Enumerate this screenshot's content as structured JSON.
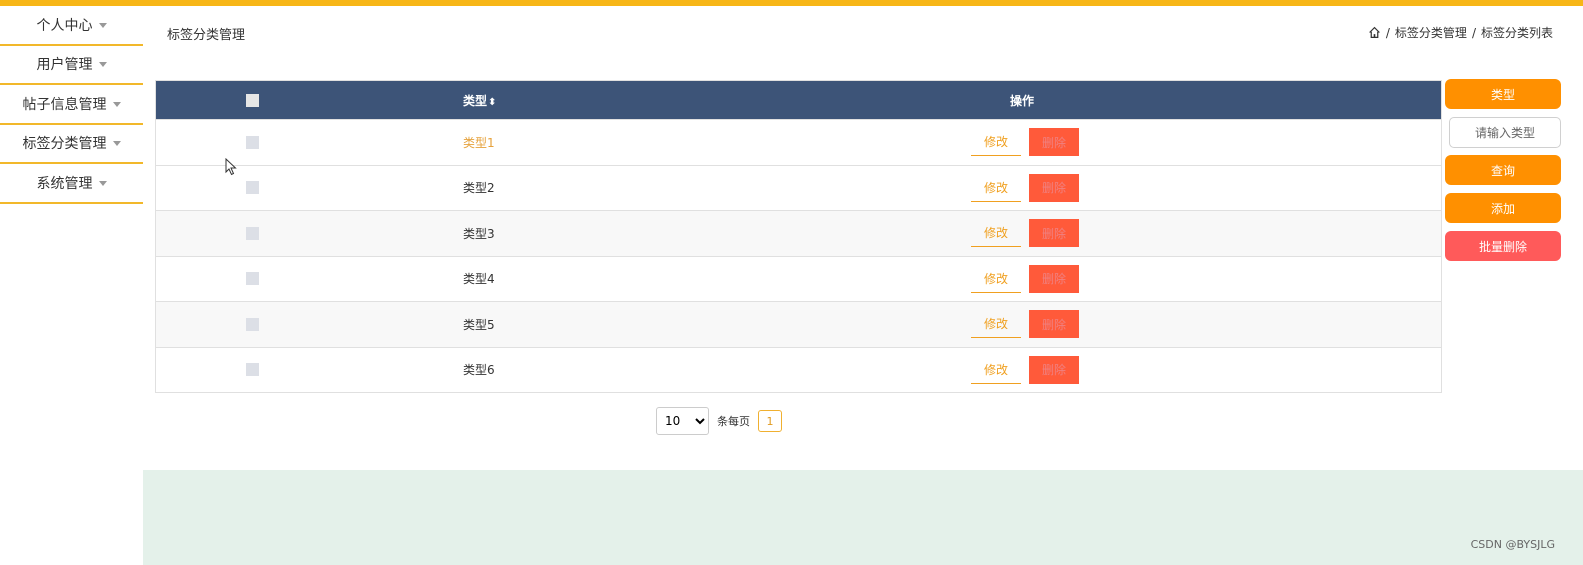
{
  "sidebar": {
    "items": [
      {
        "label": "个人中心"
      },
      {
        "label": "用户管理"
      },
      {
        "label": "帖子信息管理"
      },
      {
        "label": "标签分类管理"
      },
      {
        "label": "系统管理"
      }
    ]
  },
  "header": {
    "title": "标签分类管理",
    "breadcrumb": [
      "标签分类管理",
      "标签分类列表"
    ],
    "separator": "/"
  },
  "table": {
    "columns": {
      "type": "类型",
      "sort_icon": "⬍",
      "operation": "操作"
    },
    "rows": [
      {
        "type": "类型1",
        "edit": "修改",
        "delete": "删除"
      },
      {
        "type": "类型2",
        "edit": "修改",
        "delete": "删除"
      },
      {
        "type": "类型3",
        "edit": "修改",
        "delete": "删除"
      },
      {
        "type": "类型4",
        "edit": "修改",
        "delete": "删除"
      },
      {
        "type": "类型5",
        "edit": "修改",
        "delete": "删除"
      },
      {
        "type": "类型6",
        "edit": "修改",
        "delete": "删除"
      }
    ]
  },
  "actions": {
    "type_button": "类型",
    "search_placeholder": "请输入类型",
    "query_button": "查询",
    "add_button": "添加",
    "batch_delete_button": "批量删除"
  },
  "pagination": {
    "page_size": "10",
    "page_size_options": [
      "10"
    ],
    "per_page_label": "条每页",
    "current_page": "1"
  },
  "watermark": "CSDN @BYSJLG",
  "colors": {
    "accent": "#f7b617",
    "header_bg": "#3d5478",
    "primary_button": "#ff9000",
    "danger_button": "#ff5a5a",
    "footer_bg": "#e4f1ea"
  }
}
